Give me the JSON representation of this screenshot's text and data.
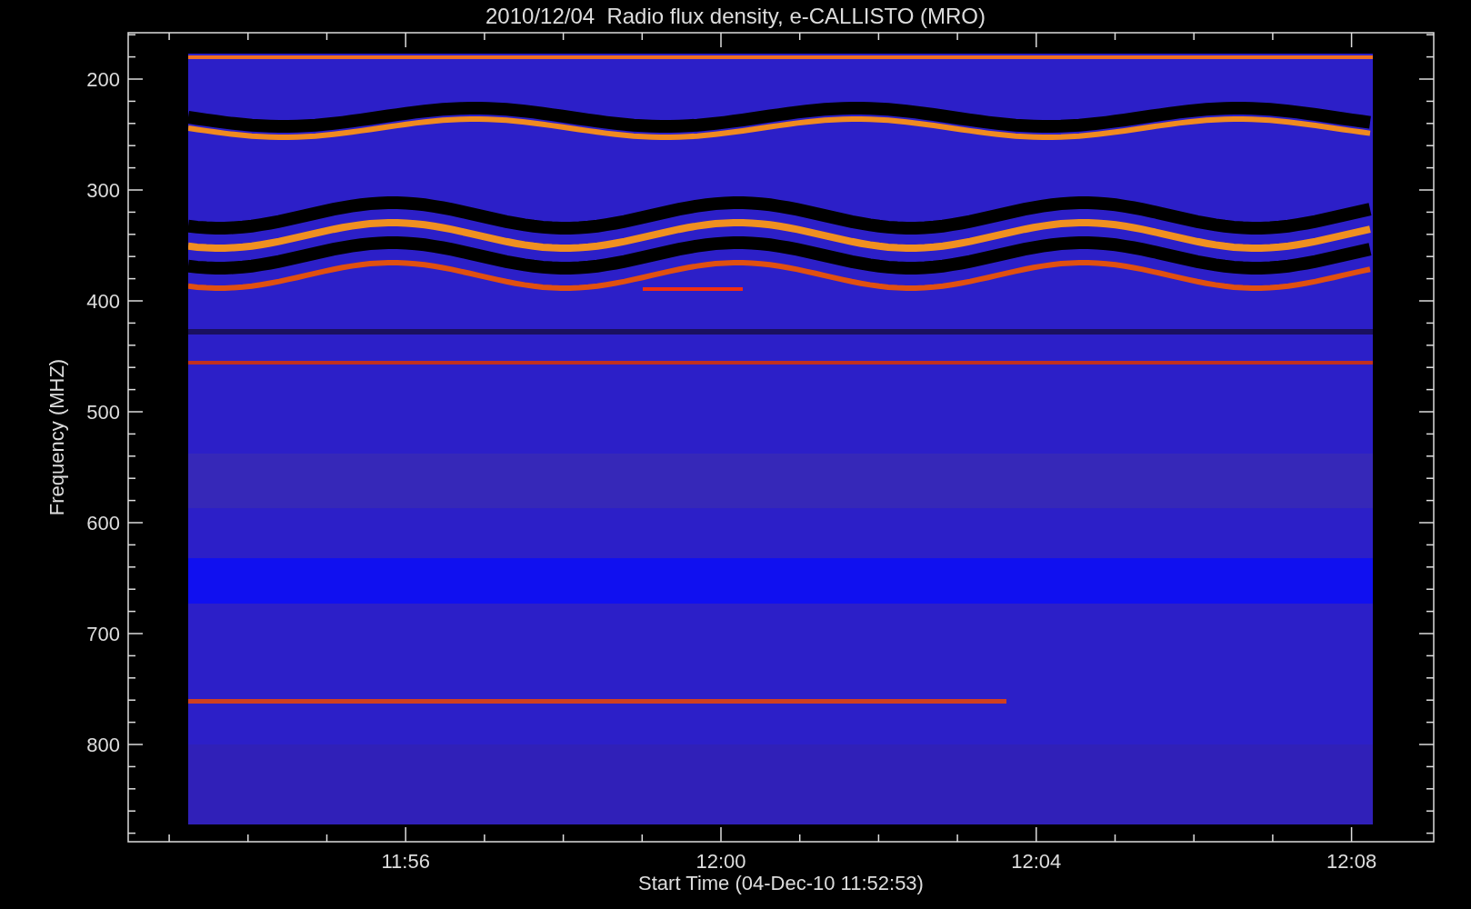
{
  "title": "2010/12/04  Radio flux density, e-CALLISTO (MRO)",
  "ylabel": "Frequency (MHZ)",
  "xlabel": "Start Time (04-Dec-10 11:52:53)",
  "yticks": [
    "200",
    "300",
    "400",
    "500",
    "600",
    "700",
    "800"
  ],
  "xticks": [
    "11:56",
    "12:00",
    "12:04",
    "12:08"
  ]
}
